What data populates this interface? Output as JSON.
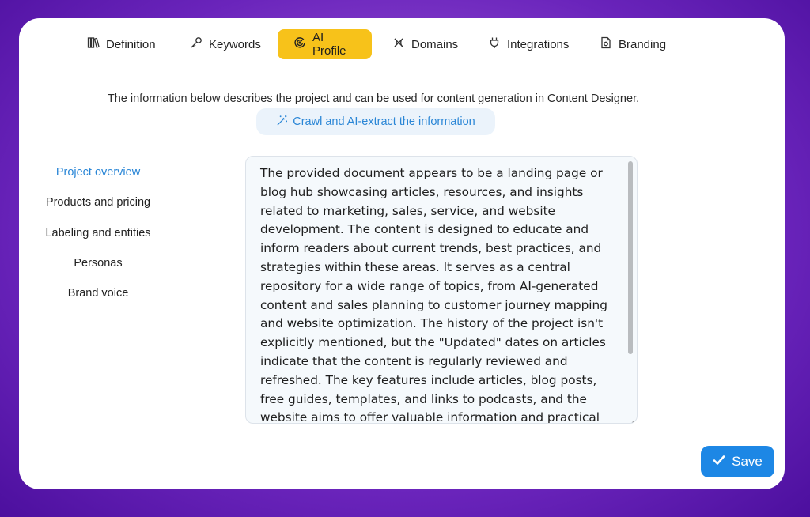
{
  "tabs": [
    {
      "label": "Definition",
      "icon": "books-icon"
    },
    {
      "label": "Keywords",
      "icon": "key-icon"
    },
    {
      "label": "AI Profile",
      "icon": "ai-swirl-icon",
      "active": true
    },
    {
      "label": "Domains",
      "icon": "globe-icon"
    },
    {
      "label": "Integrations",
      "icon": "plug-icon"
    },
    {
      "label": "Branding",
      "icon": "document-icon"
    }
  ],
  "info_text": "The information below describes the project and can be used for content generation in Content Designer.",
  "crawl_button": {
    "label": "Crawl and AI-extract the information",
    "icon": "magic-wand-icon"
  },
  "side_nav": {
    "items": [
      {
        "label": "Project overview",
        "active": true
      },
      {
        "label": "Products and pricing"
      },
      {
        "label": "Labeling and entities"
      },
      {
        "label": "Personas"
      },
      {
        "label": "Brand voice"
      }
    ]
  },
  "overview_text": "The provided document appears to be a landing page or blog hub showcasing articles, resources, and insights related to marketing, sales, service, and website development. The content is designed to educate and inform readers about current trends, best practices, and strategies within these areas. It serves as a central repository for a wide range of topics, from AI-generated content and sales planning to customer journey mapping and website optimization. The history of the project isn't explicitly mentioned, but the \"Updated\" dates on articles indicate that the content is regularly reviewed and refreshed. The key features include articles, blog posts, free guides, templates, and links to podcasts, and the website aims to offer valuable information and practical",
  "save_button": {
    "label": "Save",
    "icon": "check-icon"
  },
  "colors": {
    "accent_yellow": "#f7c21a",
    "link_blue": "#2a86d6",
    "save_blue": "#1d87e5",
    "background_purple": "#6a24bb"
  }
}
